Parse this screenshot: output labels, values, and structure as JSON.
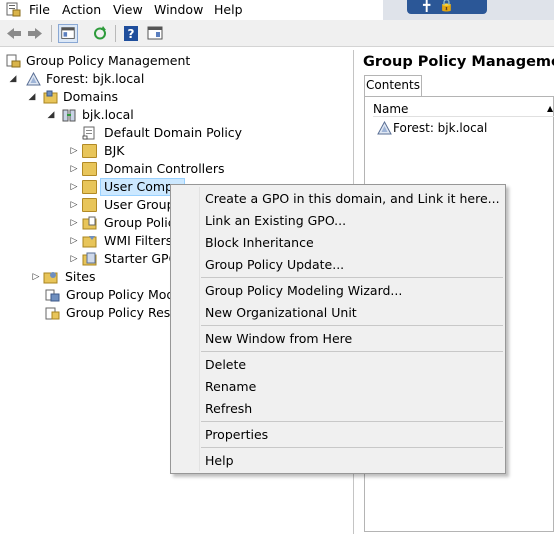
{
  "menubar": {
    "items": [
      "File",
      "Action",
      "View",
      "Window",
      "Help"
    ]
  },
  "tree": {
    "root": "Group Policy Management",
    "forest": "Forest: bjk.local",
    "domains": "Domains",
    "domain": "bjk.local",
    "children": [
      "Default Domain Policy",
      "BJK",
      "Domain Controllers",
      "User Compu",
      "User Groups",
      "Group Policy",
      "WMI Filters",
      "Starter GPOs"
    ],
    "sites": "Sites",
    "modeling": "Group Policy Model",
    "results": "Group Policy Result"
  },
  "right": {
    "title": "Group Policy Management",
    "tab": "Contents",
    "column": "Name",
    "row": "Forest: bjk.local"
  },
  "context_menu": {
    "items": [
      "Create a GPO in this domain, and Link it here...",
      "Link an Existing GPO...",
      "Block Inheritance",
      "Group Policy Update...",
      "Group Policy Modeling Wizard...",
      "New Organizational Unit",
      "New Window from Here",
      "Delete",
      "Rename",
      "Refresh",
      "Properties",
      "Help"
    ]
  },
  "colors": {
    "selection": "#cce8ff",
    "menu_bg": "#f0f0f0",
    "title_accent": "#2b5797"
  }
}
